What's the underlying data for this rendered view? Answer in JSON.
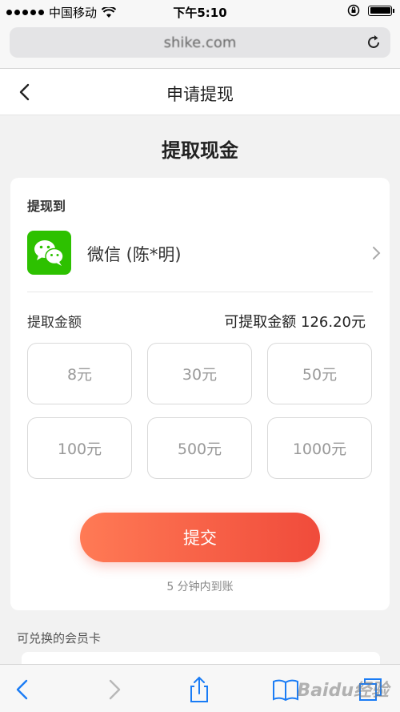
{
  "status_bar": {
    "carrier": "中国移动",
    "time": "下午5:10"
  },
  "browser": {
    "url": "shike.com"
  },
  "header": {
    "title": "申请提现"
  },
  "page": {
    "title": "提取现金"
  },
  "withdraw": {
    "to_label": "提现到",
    "account_label": "微信 (陈*明)",
    "amount_label": "提取金额",
    "available_label": "可提取金额 126.20元",
    "amounts": [
      "8元",
      "30元",
      "50元",
      "100元",
      "500元",
      "1000元"
    ],
    "submit_label": "提交",
    "arrival_note": "5 分钟内到账"
  },
  "member_cards": {
    "label": "可兑换的会员卡"
  },
  "watermark": "Baidu经验",
  "colors": {
    "accent": "#f04b3b",
    "wechat": "#2dc100",
    "ios_blue": "#1a7cf5"
  }
}
